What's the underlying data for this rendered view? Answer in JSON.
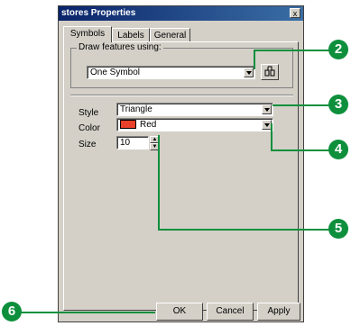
{
  "window": {
    "title": "stores Properties",
    "close_glyph": "x"
  },
  "tabs": [
    {
      "label": "Symbols",
      "active": true
    },
    {
      "label": "Labels",
      "active": false
    },
    {
      "label": "General",
      "active": false
    }
  ],
  "draw": {
    "group_label": "Draw features using:",
    "value": "One Symbol"
  },
  "style": {
    "label": "Style",
    "value": "Triangle"
  },
  "color": {
    "label": "Color",
    "value": "Red",
    "swatch": "#e8402a"
  },
  "size": {
    "label": "Size",
    "value": "10"
  },
  "buttons": {
    "ok": "OK",
    "cancel": "Cancel",
    "apply": "Apply"
  },
  "callouts": {
    "c2": "2",
    "c3": "3",
    "c4": "4",
    "c5": "5",
    "c6": "6",
    "color": "#0d8f3c"
  }
}
